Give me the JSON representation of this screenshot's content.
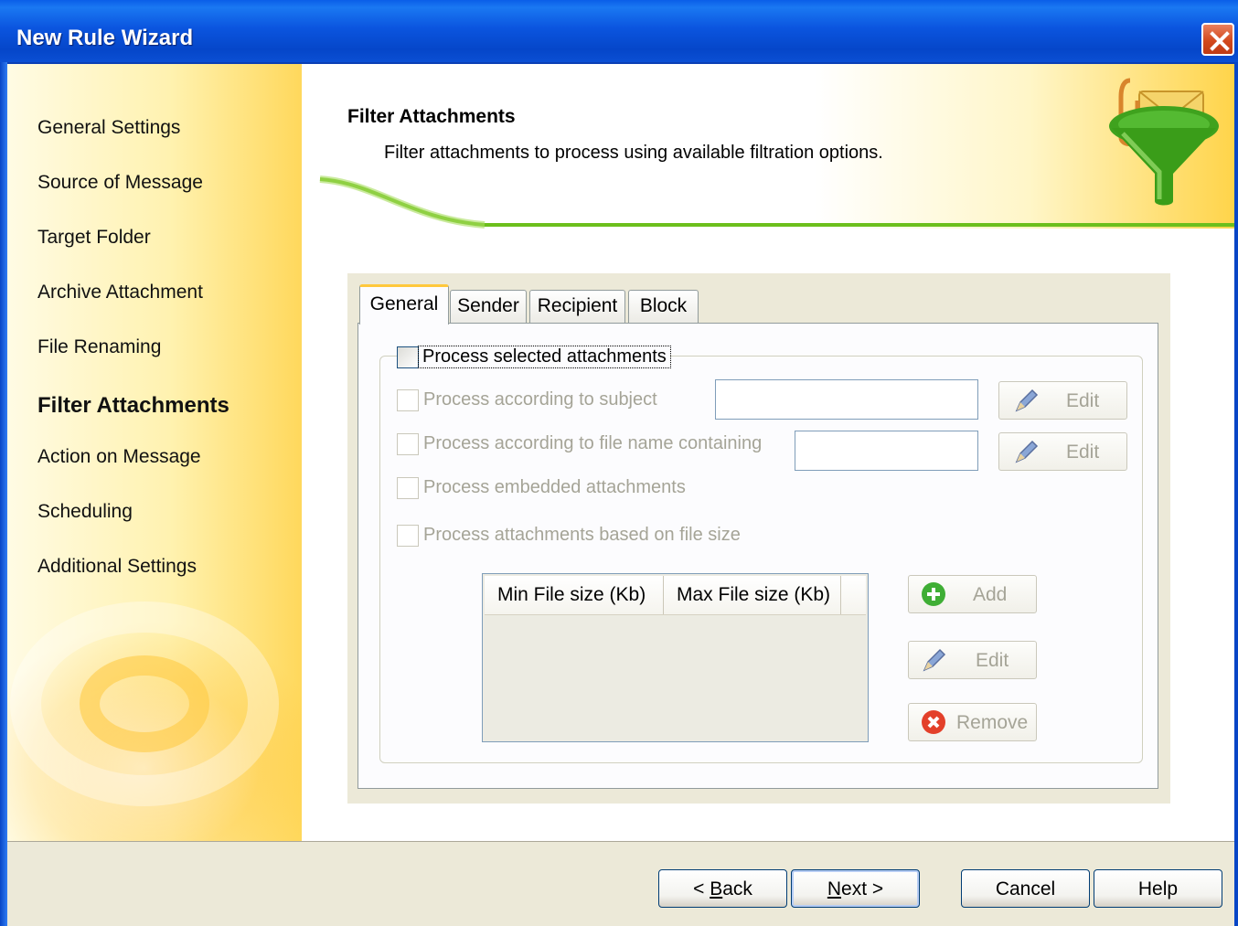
{
  "window": {
    "title": "New Rule Wizard"
  },
  "nav": {
    "items": [
      {
        "label": "General Settings"
      },
      {
        "label": "Source of Message"
      },
      {
        "label": "Target Folder"
      },
      {
        "label": "Archive Attachment"
      },
      {
        "label": "File Renaming"
      },
      {
        "label": "Filter Attachments"
      },
      {
        "label": "Action on Message"
      },
      {
        "label": "Scheduling"
      },
      {
        "label": "Additional Settings"
      }
    ],
    "active_index": 5
  },
  "header": {
    "title": "Filter Attachments",
    "subtitle": "Filter attachments to process using available filtration options.",
    "icon": "funnel-attachment-icon"
  },
  "tabs": [
    {
      "label": "General"
    },
    {
      "label": "Sender"
    },
    {
      "label": "Recipient"
    },
    {
      "label": "Block"
    }
  ],
  "general": {
    "process_selected": {
      "label": "Process selected attachments",
      "checked": false
    },
    "by_subject": {
      "label": "Process according to subject",
      "checked": false,
      "value": "",
      "edit_label": "Edit"
    },
    "by_filename": {
      "label": "Process according to file name containing",
      "checked": false,
      "value": "",
      "edit_label": "Edit"
    },
    "embedded": {
      "label": "Process embedded attachments",
      "checked": false
    },
    "by_size": {
      "label": "Process attachments based on file size",
      "checked": false
    },
    "size_table": {
      "columns": [
        "Min File size (Kb)",
        "Max File size (Kb)"
      ],
      "rows": []
    },
    "add_label": "Add",
    "edit_label": "Edit",
    "remove_label": "Remove"
  },
  "footer": {
    "back_prefix": "< ",
    "back_key": "B",
    "back_rest": "ack",
    "next_key": "N",
    "next_rest": "ext >",
    "cancel": "Cancel",
    "help": "Help"
  },
  "colors": {
    "titlebar": "#0b55df",
    "accent_green": "#6cbf1c",
    "panel_yellow": "#ffd85c",
    "add_icon": "#3fae35",
    "remove_icon": "#e3402a"
  }
}
